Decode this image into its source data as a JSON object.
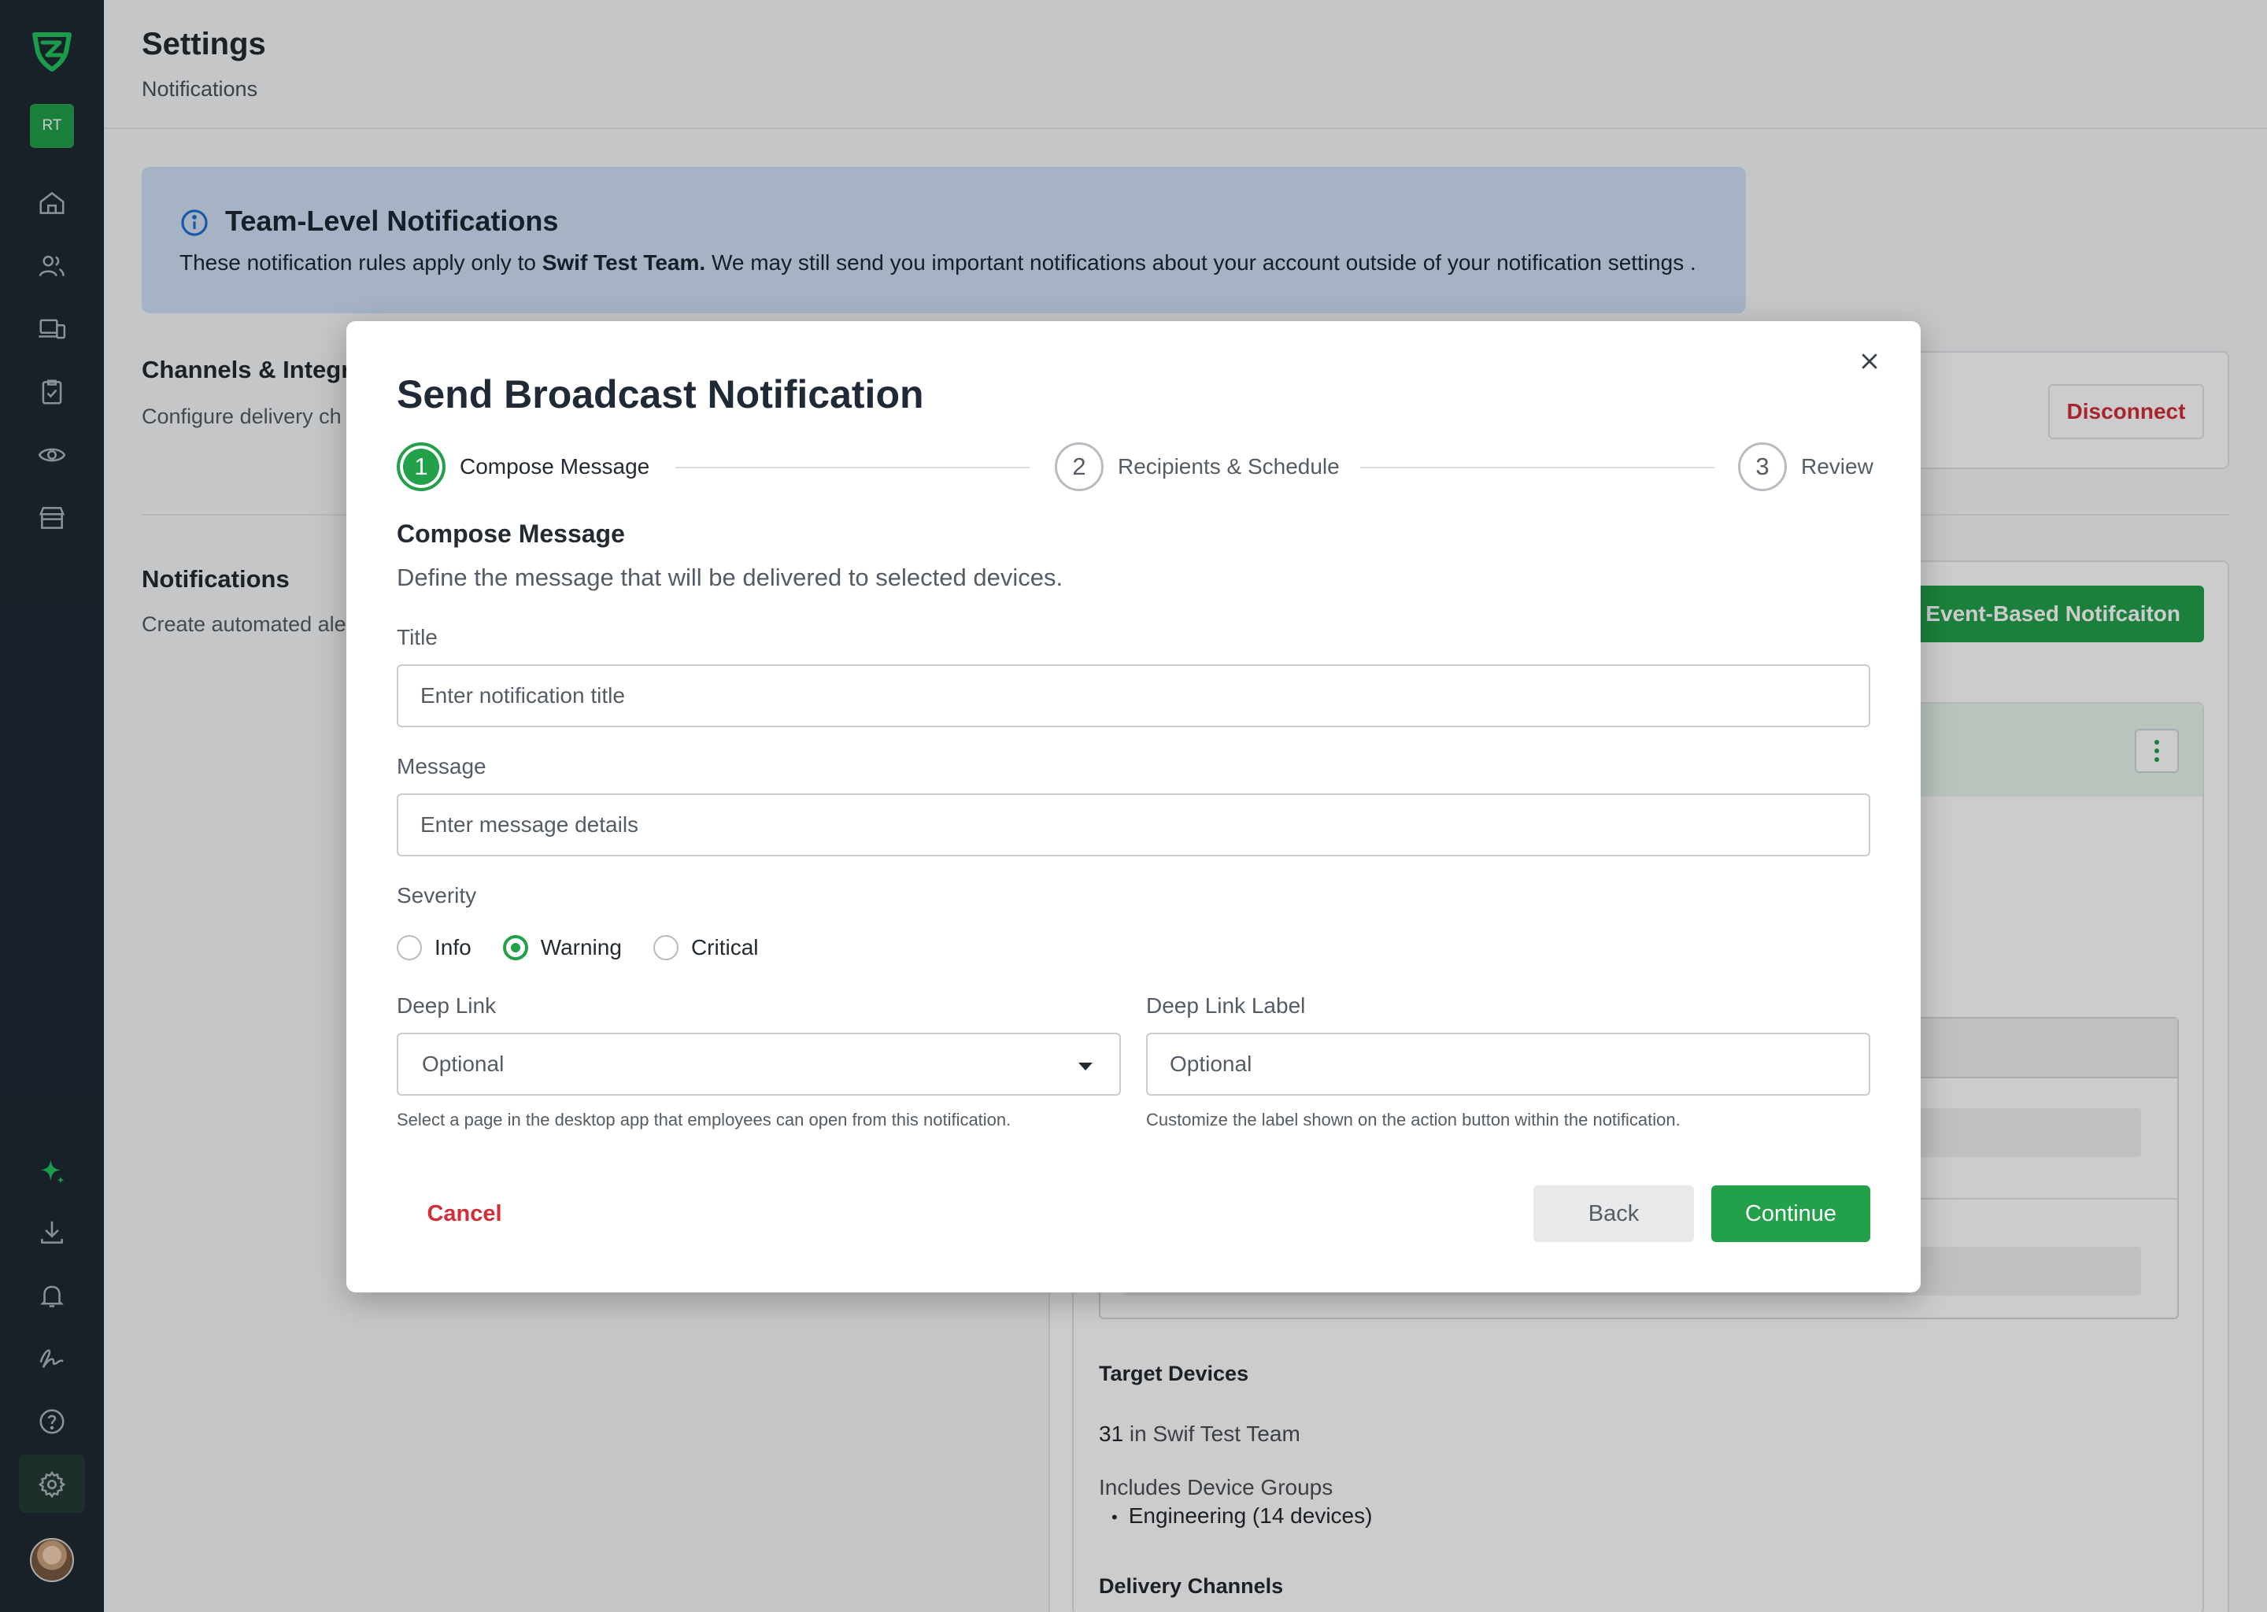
{
  "sidebar": {
    "user_initials": "RT",
    "icons": [
      "shield-logo-icon",
      "home-icon",
      "users-icon",
      "devices-icon",
      "clipboard-check-icon",
      "eye-icon",
      "store-icon",
      "sparkle-icon",
      "download-icon",
      "bell-icon",
      "signature-icon",
      "help-icon",
      "gear-icon"
    ],
    "accent": "#22a04a"
  },
  "header": {
    "title": "Settings",
    "subtitle": "Notifications"
  },
  "banner": {
    "title": "Team-Level Notifications",
    "text_prefix": "These notification rules apply only to ",
    "team_name": "Swif Test Team.",
    "text_suffix": " We may still send you important notifications about your account outside of your notification settings ."
  },
  "channels": {
    "title": "Channels & Integra",
    "subtitle": "Configure delivery ch",
    "disconnect_label": "Disconnect"
  },
  "notifications": {
    "title": "Notifications",
    "subtitle": "Create automated ale",
    "create_button": "e Event-Based Notifcaiton"
  },
  "target_devices": {
    "title": "Target Devices",
    "count": "31",
    "count_suffix": " in Swif Test Team",
    "groups_label": "Includes Device Groups",
    "groups": [
      "Engineering (14 devices)"
    ],
    "delivery_title": "Delivery Channels"
  },
  "modal": {
    "title": "Send Broadcast Notification",
    "steps": [
      {
        "number": "1",
        "label": "Compose Message",
        "active": true
      },
      {
        "number": "2",
        "label": "Recipients & Schedule",
        "active": false
      },
      {
        "number": "3",
        "label": "Review",
        "active": false
      }
    ],
    "section_title": "Compose Message",
    "section_subtitle": "Define the message that will be delivered to selected devices.",
    "title_label": "Title",
    "title_placeholder": "Enter notification title",
    "message_label": "Message",
    "message_placeholder": "Enter message details",
    "severity_label": "Severity",
    "severity_options": [
      "Info",
      "Warning",
      "Critical"
    ],
    "severity_selected": "Warning",
    "deep_link_label": "Deep Link",
    "deep_link_value": "Optional",
    "deep_link_hint": "Select a page in the desktop app that employees can open from this notification.",
    "deep_link_label_label": "Deep Link Label",
    "deep_link_label_placeholder": "Optional",
    "deep_link_label_hint": "Customize the label shown on the action button within the notification.",
    "cancel_label": "Cancel",
    "back_label": "Back",
    "continue_label": "Continue"
  }
}
